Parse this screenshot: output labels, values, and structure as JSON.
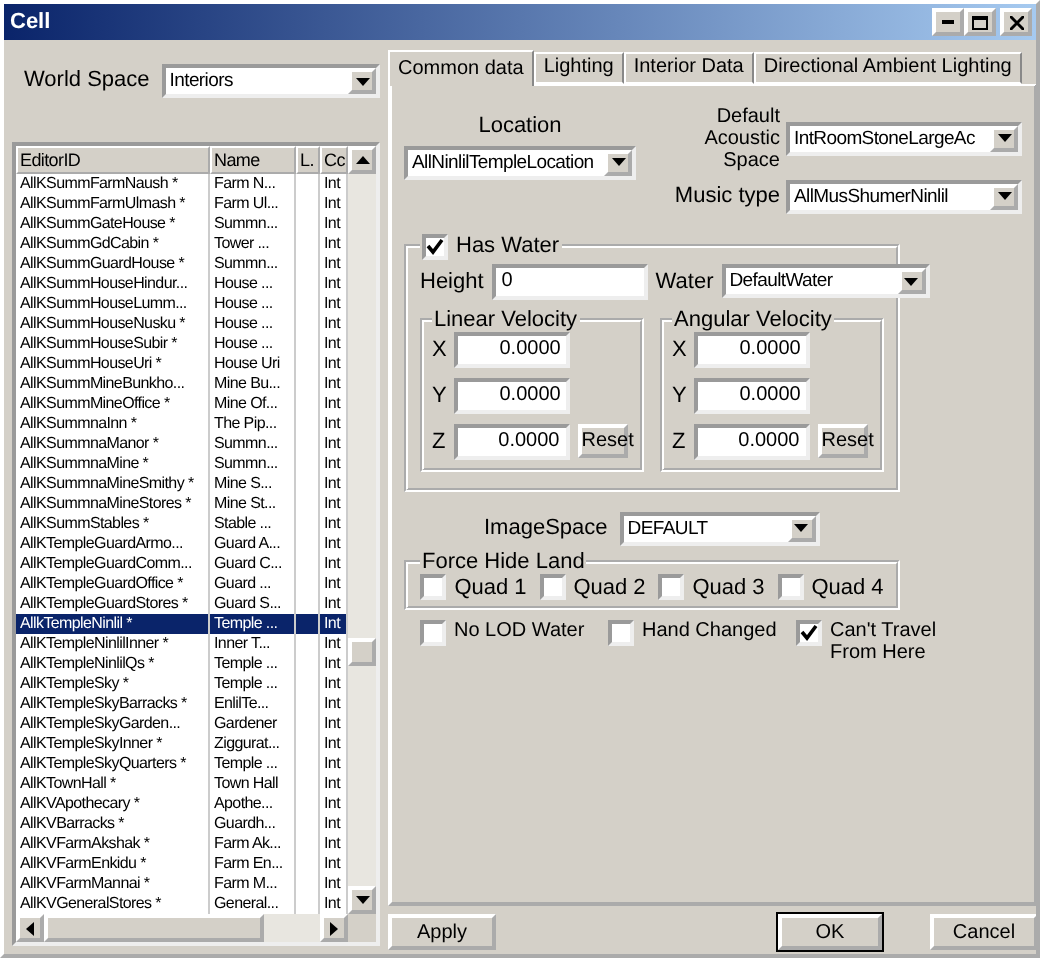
{
  "window": {
    "title": "Cell"
  },
  "world_space": {
    "label": "World Space",
    "value": "Interiors"
  },
  "cell_list": {
    "columns": [
      "EditorID",
      "Name",
      "L.",
      "Cc"
    ],
    "rows": [
      {
        "cells": [
          "AllKSummFarmNaush *",
          "Farm N...",
          "",
          "Int"
        ],
        "selected": false
      },
      {
        "cells": [
          "AllKSummFarmUlmash *",
          "Farm Ul...",
          "",
          "Int"
        ],
        "selected": false
      },
      {
        "cells": [
          "AllKSummGateHouse *",
          "Summn...",
          "",
          "Int"
        ],
        "selected": false
      },
      {
        "cells": [
          "AllKSummGdCabin *",
          "Tower ...",
          "",
          "Int"
        ],
        "selected": false
      },
      {
        "cells": [
          "AllKSummGuardHouse *",
          "Summn...",
          "",
          "Int"
        ],
        "selected": false
      },
      {
        "cells": [
          "AllKSummHouseHindur...",
          "House ...",
          "",
          "Int"
        ],
        "selected": false
      },
      {
        "cells": [
          "AllKSummHouseLumm...",
          "House ...",
          "",
          "Int"
        ],
        "selected": false
      },
      {
        "cells": [
          "AllKSummHouseNusku *",
          "House ...",
          "",
          "Int"
        ],
        "selected": false
      },
      {
        "cells": [
          "AllKSummHouseSubir *",
          "House ...",
          "",
          "Int"
        ],
        "selected": false
      },
      {
        "cells": [
          "AllKSummHouseUri *",
          "House Uri",
          "",
          "Int"
        ],
        "selected": false
      },
      {
        "cells": [
          "AllKSummMineBunkho...",
          "Mine Bu...",
          "",
          "Int"
        ],
        "selected": false
      },
      {
        "cells": [
          "AllKSummMineOffice *",
          "Mine Of...",
          "",
          "Int"
        ],
        "selected": false
      },
      {
        "cells": [
          "AllKSummnaInn *",
          "The Pip...",
          "",
          "Int"
        ],
        "selected": false
      },
      {
        "cells": [
          "AllKSummnaManor *",
          "Summn...",
          "",
          "Int"
        ],
        "selected": false
      },
      {
        "cells": [
          "AllKSummnaMine *",
          "Summn...",
          "",
          "Int"
        ],
        "selected": false
      },
      {
        "cells": [
          "AllKSummnaMineSmithy *",
          "Mine S...",
          "",
          "Int"
        ],
        "selected": false
      },
      {
        "cells": [
          "AllKSummnaMineStores *",
          "Mine St...",
          "",
          "Int"
        ],
        "selected": false
      },
      {
        "cells": [
          "AllKSummStables *",
          "Stable ...",
          "",
          "Int"
        ],
        "selected": false
      },
      {
        "cells": [
          "AllKTempleGuardArmo...",
          "Guard A...",
          "",
          "Int"
        ],
        "selected": false
      },
      {
        "cells": [
          "AllKTempleGuardComm...",
          "Guard C...",
          "",
          "Int"
        ],
        "selected": false
      },
      {
        "cells": [
          "AllKTempleGuardOffice *",
          "Guard ...",
          "",
          "Int"
        ],
        "selected": false
      },
      {
        "cells": [
          "AllKTempleGuardStores *",
          "Guard S...",
          "",
          "Int"
        ],
        "selected": false
      },
      {
        "cells": [
          "AllkTempleNinlil *",
          "Temple ...",
          "",
          "Int"
        ],
        "selected": true
      },
      {
        "cells": [
          "AllKTempleNinlilInner *",
          "Inner T...",
          "",
          "Int"
        ],
        "selected": false
      },
      {
        "cells": [
          "AllKTempleNinlilQs *",
          "Temple ...",
          "",
          "Int"
        ],
        "selected": false
      },
      {
        "cells": [
          "AllKTempleSky *",
          "Temple ...",
          "",
          "Int"
        ],
        "selected": false
      },
      {
        "cells": [
          "AllKTempleSkyBarracks *",
          "EnlilTe...",
          "",
          "Int"
        ],
        "selected": false
      },
      {
        "cells": [
          "AllKTempleSkyGarden...",
          "Gardener",
          "",
          "Int"
        ],
        "selected": false
      },
      {
        "cells": [
          "AllKTempleSkyInner *",
          "Ziggurat...",
          "",
          "Int"
        ],
        "selected": false
      },
      {
        "cells": [
          "AllKTempleSkyQuarters *",
          "Temple ...",
          "",
          "Int"
        ],
        "selected": false
      },
      {
        "cells": [
          "AllKTownHall *",
          "Town Hall",
          "",
          "Int"
        ],
        "selected": false
      },
      {
        "cells": [
          "AllKVApothecary *",
          "Apothe...",
          "",
          "Int"
        ],
        "selected": false
      },
      {
        "cells": [
          "AllKVBarracks *",
          "Guardh...",
          "",
          "Int"
        ],
        "selected": false
      },
      {
        "cells": [
          "AllKVFarmAkshak *",
          "Farm Ak...",
          "",
          "Int"
        ],
        "selected": false
      },
      {
        "cells": [
          "AllKVFarmEnkidu *",
          "Farm En...",
          "",
          "Int"
        ],
        "selected": false
      },
      {
        "cells": [
          "AllKVFarmMannai *",
          "Farm M...",
          "",
          "Int"
        ],
        "selected": false
      },
      {
        "cells": [
          "AllKVGeneralStores *",
          "General...",
          "",
          "Int"
        ],
        "selected": false
      }
    ]
  },
  "tabs": [
    {
      "label": "Common data",
      "selected": true
    },
    {
      "label": "Lighting",
      "selected": false
    },
    {
      "label": "Interior Data",
      "selected": false
    },
    {
      "label": "Directional Ambient Lighting",
      "selected": false
    }
  ],
  "location": {
    "label": "Location",
    "value": "AllNinlilTempleLocation"
  },
  "acoustic_space": {
    "label": "Default Acoustic Space",
    "value": "IntRoomStoneLargeAc"
  },
  "music_type": {
    "label": "Music type",
    "value": "AllMusShumerNinlil"
  },
  "has_water": {
    "label": "Has Water",
    "checked": true
  },
  "height": {
    "label": "Height",
    "value": "0"
  },
  "water": {
    "label": "Water",
    "value": "DefaultWater"
  },
  "velocities": [
    {
      "title": "Linear Velocity",
      "axes": [
        {
          "label": "X",
          "value": "0.0000"
        },
        {
          "label": "Y",
          "value": "0.0000"
        },
        {
          "label": "Z",
          "value": "0.0000"
        }
      ],
      "reset": "Reset"
    },
    {
      "title": "Angular Velocity",
      "axes": [
        {
          "label": "X",
          "value": "0.0000"
        },
        {
          "label": "Y",
          "value": "0.0000"
        },
        {
          "label": "Z",
          "value": "0.0000"
        }
      ],
      "reset": "Reset"
    }
  ],
  "image_space": {
    "label": "ImageSpace",
    "value": "DEFAULT"
  },
  "force_hide_land": {
    "title": "Force Hide Land",
    "quads": [
      {
        "label": "Quad 1",
        "checked": false
      },
      {
        "label": "Quad 2",
        "checked": false
      },
      {
        "label": "Quad 3",
        "checked": false
      },
      {
        "label": "Quad 4",
        "checked": false
      }
    ]
  },
  "flags": [
    {
      "label": "No LOD Water",
      "checked": false
    },
    {
      "label": "Hand Changed",
      "checked": false
    },
    {
      "label": "Can't Travel From Here",
      "checked": true
    }
  ],
  "buttons": {
    "apply": "Apply",
    "ok": "OK",
    "cancel": "Cancel"
  }
}
